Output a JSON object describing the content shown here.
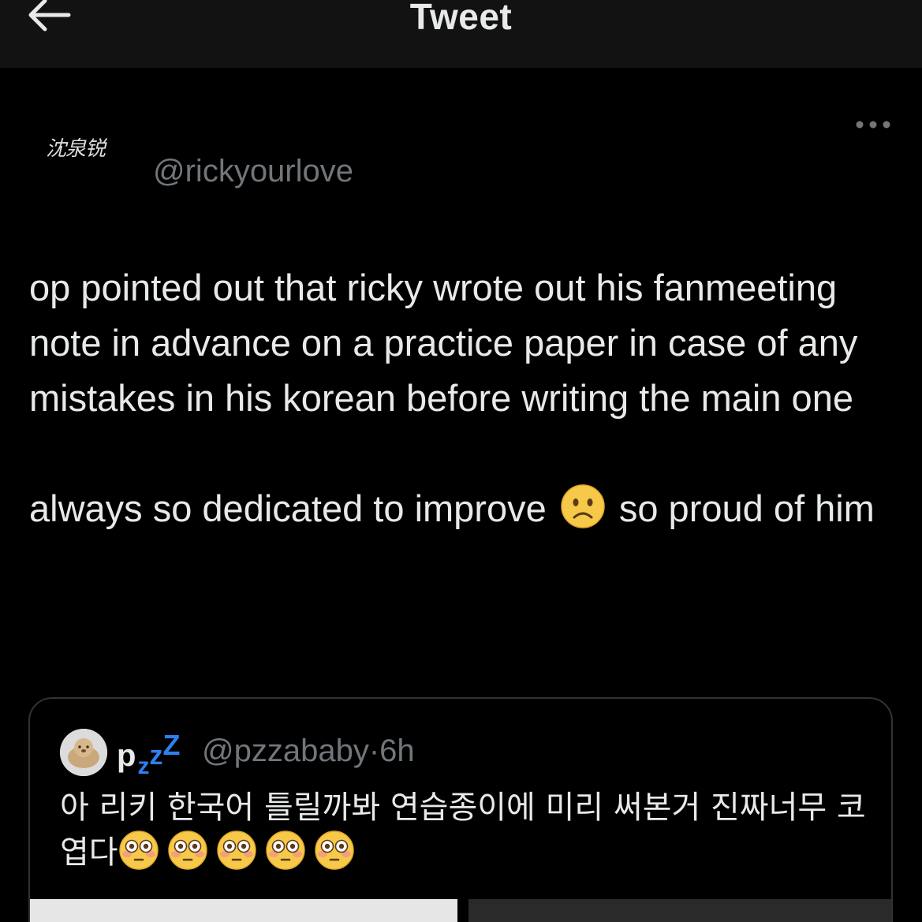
{
  "topbar": {
    "title": "Tweet"
  },
  "author": {
    "display_name": "沈泉锐",
    "handle": "@rickyourlove"
  },
  "tweet": {
    "paragraph1": "op pointed out that ricky wrote out his fanmeeting note in advance on a practice paper in case of any mistakes in his korean before writing the main one",
    "paragraph2_before_emoji": "always so dedicated to improve",
    "paragraph2_emoji": "slightly-frowning-face",
    "paragraph2_after_emoji": "so proud of him"
  },
  "quote": {
    "display_name": "p",
    "name_z1": "z",
    "name_z2": "z",
    "name_z3": "Z",
    "handle": "@pzzababy",
    "separator": "·",
    "time": "6h",
    "text": "아 리키 한국어 틀릴까봐 연습종이에 미리 써본거 진짜너무 코엽다",
    "emojis": [
      "flushed-face",
      "flushed-face",
      "flushed-face",
      "flushed-face",
      "flushed-face"
    ]
  },
  "colors": {
    "background": "#000000",
    "topbar": "#121212",
    "text": "#e7e9ea",
    "secondary_text": "#71767b",
    "border": "#2f3336",
    "zzz_blue": "#2f7ff0"
  }
}
